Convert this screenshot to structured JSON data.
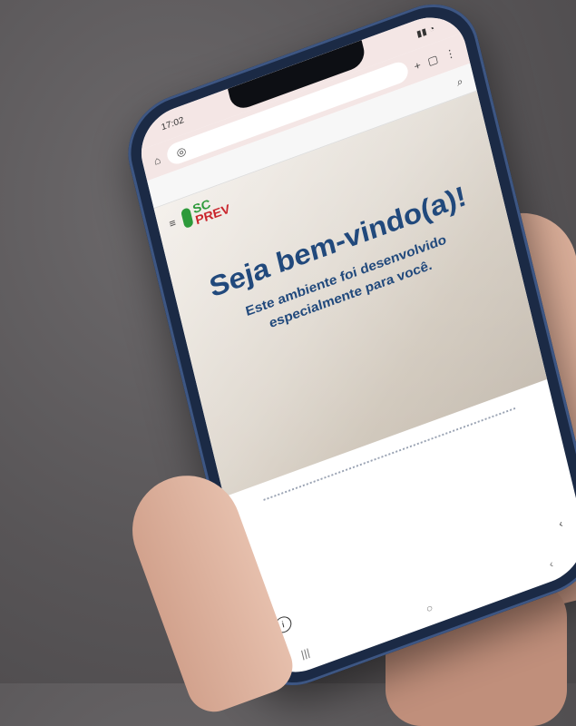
{
  "status": {
    "time": "17:02",
    "right": ""
  },
  "browser": {
    "url": ""
  },
  "site": {
    "title": ""
  },
  "hero": {
    "title": "Seja bem-vindo(a)!",
    "subtitle": "Este ambiente foi desenvolvido especialmente para você."
  },
  "footer": {
    "body": ""
  },
  "bottom": {
    "link": ""
  },
  "colors": {
    "brand_blue": "#21497c",
    "brand_green": "#2d9a3a",
    "brand_red": "#c9252c"
  }
}
